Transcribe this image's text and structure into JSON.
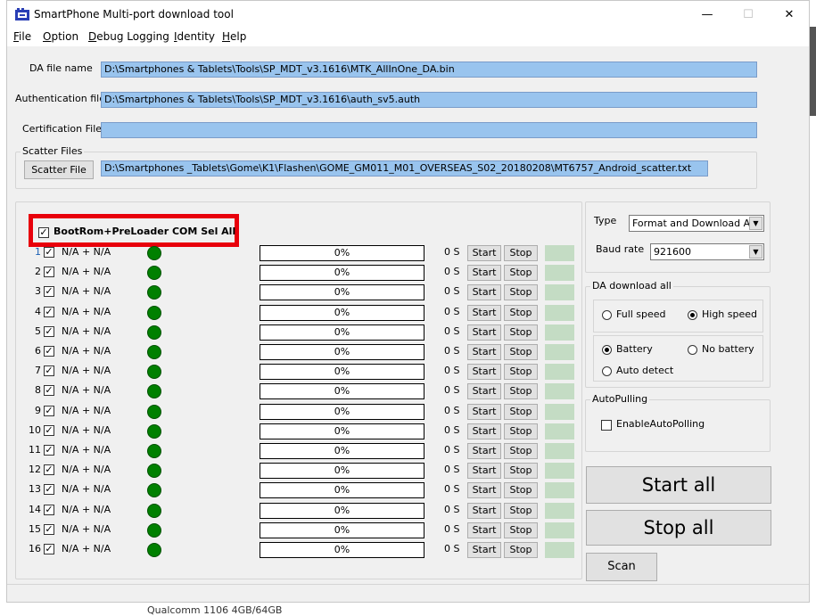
{
  "window": {
    "title": "SmartPhone Multi-port download tool",
    "minimize": "—",
    "maximize": "☐",
    "close": "✕"
  },
  "menu": [
    "File",
    "Option",
    "Debug Logging",
    "Identity",
    "Help"
  ],
  "files": {
    "da_label": "DA file name",
    "da_value": "D:\\Smartphones & Tablets\\Tools\\SP_MDT_v3.1616\\MTK_AllInOne_DA.bin",
    "auth_label": "Authentication file",
    "auth_value": "D:\\Smartphones & Tablets\\Tools\\SP_MDT_v3.1616\\auth_sv5.auth",
    "cert_label": "Certification File",
    "cert_value": "",
    "scatter_group": "Scatter Files",
    "scatter_button": "Scatter File",
    "scatter_value": "D:\\Smartphones _Tablets\\Gome\\K1\\Flashen\\GOME_GM011_M01_OVERSEAS_S02_20180208\\MT6757_Android_scatter.txt"
  },
  "ports": {
    "sel_all_label": "BootRom+PreLoader COM Sel All",
    "rows": [
      {
        "num": "1",
        "label": "N/A + N/A",
        "progress": "0%",
        "time": "0 S"
      },
      {
        "num": "2",
        "label": "N/A + N/A",
        "progress": "0%",
        "time": "0 S"
      },
      {
        "num": "3",
        "label": "N/A + N/A",
        "progress": "0%",
        "time": "0 S"
      },
      {
        "num": "4",
        "label": "N/A + N/A",
        "progress": "0%",
        "time": "0 S"
      },
      {
        "num": "5",
        "label": "N/A + N/A",
        "progress": "0%",
        "time": "0 S"
      },
      {
        "num": "6",
        "label": "N/A + N/A",
        "progress": "0%",
        "time": "0 S"
      },
      {
        "num": "7",
        "label": "N/A + N/A",
        "progress": "0%",
        "time": "0 S"
      },
      {
        "num": "8",
        "label": "N/A + N/A",
        "progress": "0%",
        "time": "0 S"
      },
      {
        "num": "9",
        "label": "N/A + N/A",
        "progress": "0%",
        "time": "0 S"
      },
      {
        "num": "10",
        "label": "N/A + N/A",
        "progress": "0%",
        "time": "0 S"
      },
      {
        "num": "11",
        "label": "N/A + N/A",
        "progress": "0%",
        "time": "0 S"
      },
      {
        "num": "12",
        "label": "N/A + N/A",
        "progress": "0%",
        "time": "0 S"
      },
      {
        "num": "13",
        "label": "N/A + N/A",
        "progress": "0%",
        "time": "0 S"
      },
      {
        "num": "14",
        "label": "N/A + N/A",
        "progress": "0%",
        "time": "0 S"
      },
      {
        "num": "15",
        "label": "N/A + N/A",
        "progress": "0%",
        "time": "0 S"
      },
      {
        "num": "16",
        "label": "N/A + N/A",
        "progress": "0%",
        "time": "0 S"
      }
    ],
    "start_label": "Start",
    "stop_label": "Stop"
  },
  "settings": {
    "type_label": "Type",
    "type_value": "Format and Download All",
    "baud_label": "Baud rate",
    "baud_value": "921600",
    "da_group": "DA download all",
    "full_speed": "Full speed",
    "high_speed": "High speed",
    "battery": "Battery",
    "no_battery": "No battery",
    "auto_detect": "Auto detect",
    "autopolling_group": "AutoPulling",
    "enable_autopolling": "EnableAutoPolling",
    "start_all": "Start all",
    "stop_all": "Stop all",
    "scan": "Scan"
  },
  "footer": {
    "bottom_text": "Qualcomm 1106 4GB/64GB"
  },
  "colors": {
    "accent_highlight": "#e8000b",
    "field_bg": "#99c4ee",
    "led": "#008000",
    "status_cell": "#c4dcc4"
  }
}
